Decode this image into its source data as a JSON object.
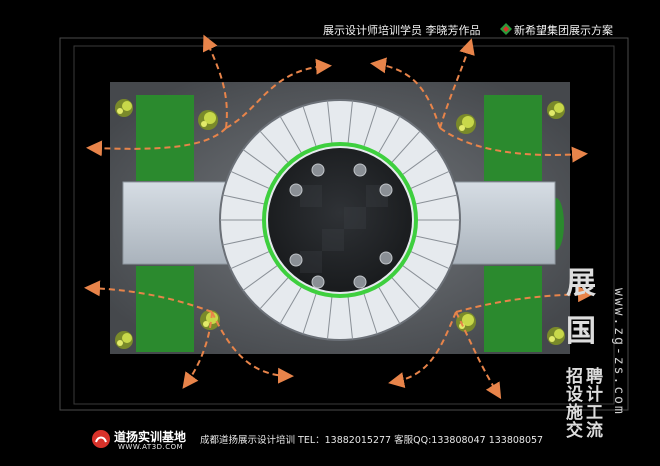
{
  "header": {
    "credit": "展示设计师培训学员  李晓芳作品",
    "brand_name": "新希望集团展示方案"
  },
  "footer": {
    "school_name": "道扬实训基地",
    "school_url": "WWW.AT3D.COM",
    "info": "成都道扬展示设计培训    TEL：13882015277  客服QQ:133808047   133808057"
  },
  "watermark": {
    "url": "www.zg-zs.com",
    "chars": [
      "展",
      "国",
      "招",
      "聘",
      "设",
      "计",
      "施",
      "工",
      "交",
      "流"
    ]
  },
  "colors": {
    "background": "#000000",
    "floor": "#5a5d61",
    "green_panel": "#2b8a2e",
    "ring_outline": "#3ecf3e",
    "arrow": "#e8844a",
    "light_wall": "#c4ccd4"
  },
  "icons": [
    "brand-logo-icon",
    "school-logo-icon",
    "flow-arrow-icon",
    "plant-icon",
    "stool-icon"
  ]
}
